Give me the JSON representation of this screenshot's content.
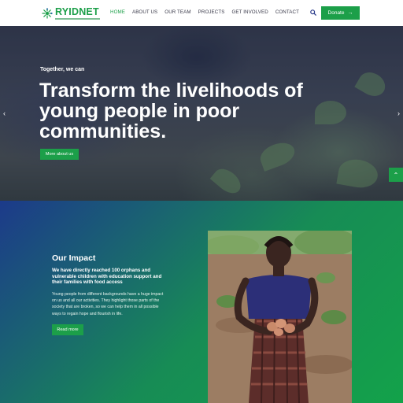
{
  "brand": {
    "name": "RYIDNET",
    "primary_color": "#1c9f49"
  },
  "nav": {
    "items": [
      {
        "label": "HOME",
        "active": true
      },
      {
        "label": "ABOUT US",
        "active": false
      },
      {
        "label": "OUR TEAM",
        "active": false
      },
      {
        "label": "PROJECTS",
        "active": false
      },
      {
        "label": "GET INVOLVED",
        "active": false
      },
      {
        "label": "CONTACT",
        "active": false
      }
    ],
    "search_icon": "search-icon",
    "donate_label": "Donate",
    "donate_icon": "arrow-right-icon"
  },
  "hero": {
    "eyebrow": "Together, we can",
    "title": "Transform the livelihoods of young people in poor communities.",
    "button_label": "More about us",
    "prev_icon": "chevron-left-icon",
    "next_icon": "chevron-right-icon"
  },
  "scroll_top_icon": "chevron-up-icon",
  "impact": {
    "title": "Our Impact",
    "subtitle": "We have directly reached 100 orphans and vulnerable children with education support and their families with food access",
    "body": "Young people from different backgrounds have a huge impact on us and all our activities. They highlight those parts of the society that are broken, so we can help them in all possible ways to regain hope and flourish in life.",
    "button_label": "Read more"
  }
}
